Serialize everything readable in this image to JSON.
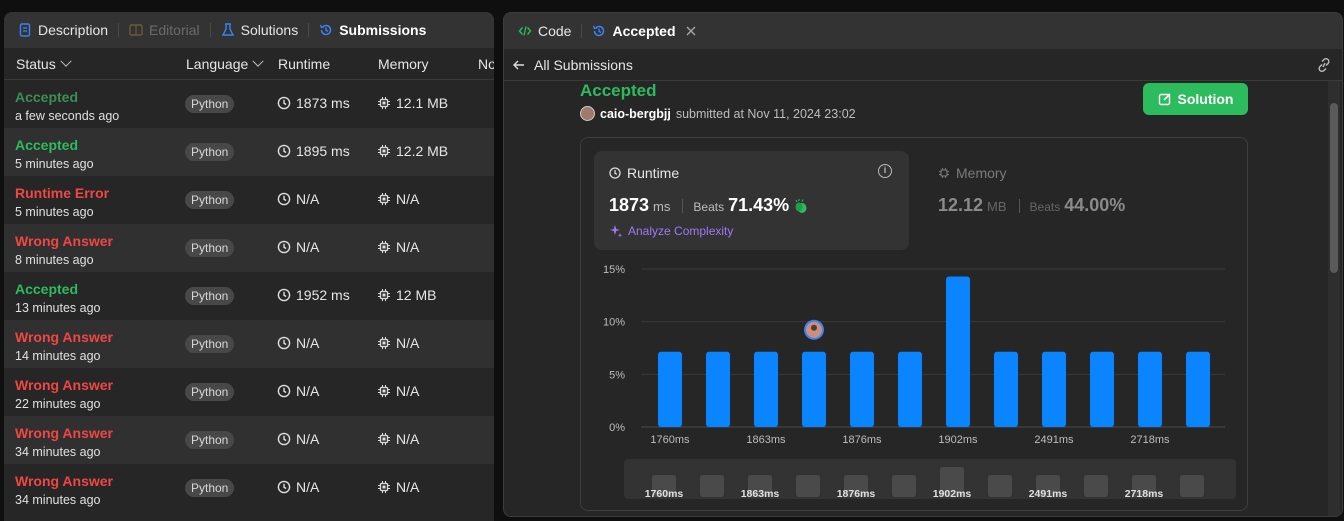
{
  "left": {
    "tabs": [
      {
        "label": "Description",
        "icon": "description-icon",
        "state": "normal"
      },
      {
        "label": "Editorial",
        "icon": "editorial-icon",
        "state": "dim"
      },
      {
        "label": "Solutions",
        "icon": "flask-icon",
        "state": "normal"
      },
      {
        "label": "Submissions",
        "icon": "history-icon",
        "state": "active"
      }
    ],
    "headers": {
      "status": "Status",
      "language": "Language",
      "runtime": "Runtime",
      "memory": "Memory",
      "notes": "No"
    },
    "rows": [
      {
        "status": "Accepted",
        "time": "a few seconds ago",
        "lang": "Python",
        "runtime": "1873 ms",
        "memory": "12.1 MB",
        "kind": "accepted-dim"
      },
      {
        "status": "Accepted",
        "time": "5 minutes ago",
        "lang": "Python",
        "runtime": "1895 ms",
        "memory": "12.2 MB",
        "kind": "accepted"
      },
      {
        "status": "Runtime Error",
        "time": "5 minutes ago",
        "lang": "Python",
        "runtime": "N/A",
        "memory": "N/A",
        "kind": "error"
      },
      {
        "status": "Wrong Answer",
        "time": "8 minutes ago",
        "lang": "Python",
        "runtime": "N/A",
        "memory": "N/A",
        "kind": "error"
      },
      {
        "status": "Accepted",
        "time": "13 minutes ago",
        "lang": "Python",
        "runtime": "1952 ms",
        "memory": "12 MB",
        "kind": "accepted"
      },
      {
        "status": "Wrong Answer",
        "time": "14 minutes ago",
        "lang": "Python",
        "runtime": "N/A",
        "memory": "N/A",
        "kind": "error"
      },
      {
        "status": "Wrong Answer",
        "time": "22 minutes ago",
        "lang": "Python",
        "runtime": "N/A",
        "memory": "N/A",
        "kind": "error"
      },
      {
        "status": "Wrong Answer",
        "time": "34 minutes ago",
        "lang": "Python",
        "runtime": "N/A",
        "memory": "N/A",
        "kind": "error"
      },
      {
        "status": "Wrong Answer",
        "time": "34 minutes ago",
        "lang": "Python",
        "runtime": "N/A",
        "memory": "N/A",
        "kind": "error"
      }
    ]
  },
  "right": {
    "tabs": {
      "code": "Code",
      "accepted": "Accepted"
    },
    "back_label": "All Submissions",
    "result_title": "Accepted",
    "username": "caio-bergbjj",
    "submitted_text": "submitted at Nov 11, 2024 23:02",
    "solution_button": "Solution",
    "runtime": {
      "label": "Runtime",
      "value": "1873",
      "unit": "ms",
      "beats_label": "Beats",
      "beats": "71.43%",
      "analyze": "Analyze Complexity"
    },
    "memory": {
      "label": "Memory",
      "value": "12.12",
      "unit": "MB",
      "beats_label": "Beats",
      "beats": "44.00%"
    }
  },
  "colors": {
    "accent_green": "#2cbb5d",
    "error_red": "#ef4743",
    "bar_blue": "#0a84ff",
    "analyze_purple": "#9b7bf5"
  },
  "chart_data": {
    "type": "bar",
    "x_tick_labels": [
      "1760ms",
      "1863ms",
      "1876ms",
      "1902ms",
      "2491ms",
      "2718ms"
    ],
    "y_tick_labels": [
      "15%",
      "10%",
      "5%",
      "0%"
    ],
    "ylim": [
      0,
      15
    ],
    "values": [
      7.14,
      7.14,
      7.14,
      7.14,
      7.14,
      7.14,
      14.29,
      7.14,
      7.14,
      7.14,
      7.14,
      7.14
    ],
    "highlight_index": 3,
    "overview_heights": [
      0.5,
      0.5,
      0.5,
      0.5,
      0.5,
      0.5,
      1.0,
      0.5,
      0.5,
      0.5,
      0.5,
      0.5
    ]
  }
}
